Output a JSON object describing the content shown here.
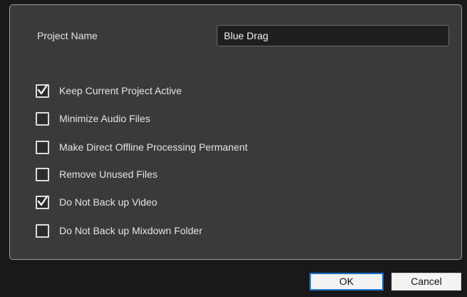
{
  "project_name": {
    "label": "Project Name",
    "value": "Blue Drag"
  },
  "options": [
    {
      "label": "Keep Current Project Active",
      "checked": true
    },
    {
      "label": "Minimize Audio Files",
      "checked": false
    },
    {
      "label": "Make Direct Offline Processing Permanent",
      "checked": false
    },
    {
      "label": "Remove Unused Files",
      "checked": false
    },
    {
      "label": "Do Not Back up Video",
      "checked": true
    },
    {
      "label": "Do Not Back up Mixdown Folder",
      "checked": false
    }
  ],
  "buttons": {
    "ok_label": "OK",
    "cancel_label": "Cancel"
  },
  "colors": {
    "panel": "#3a3a3c",
    "field": "#1f1f21",
    "ok_border": "#1a73c9"
  }
}
